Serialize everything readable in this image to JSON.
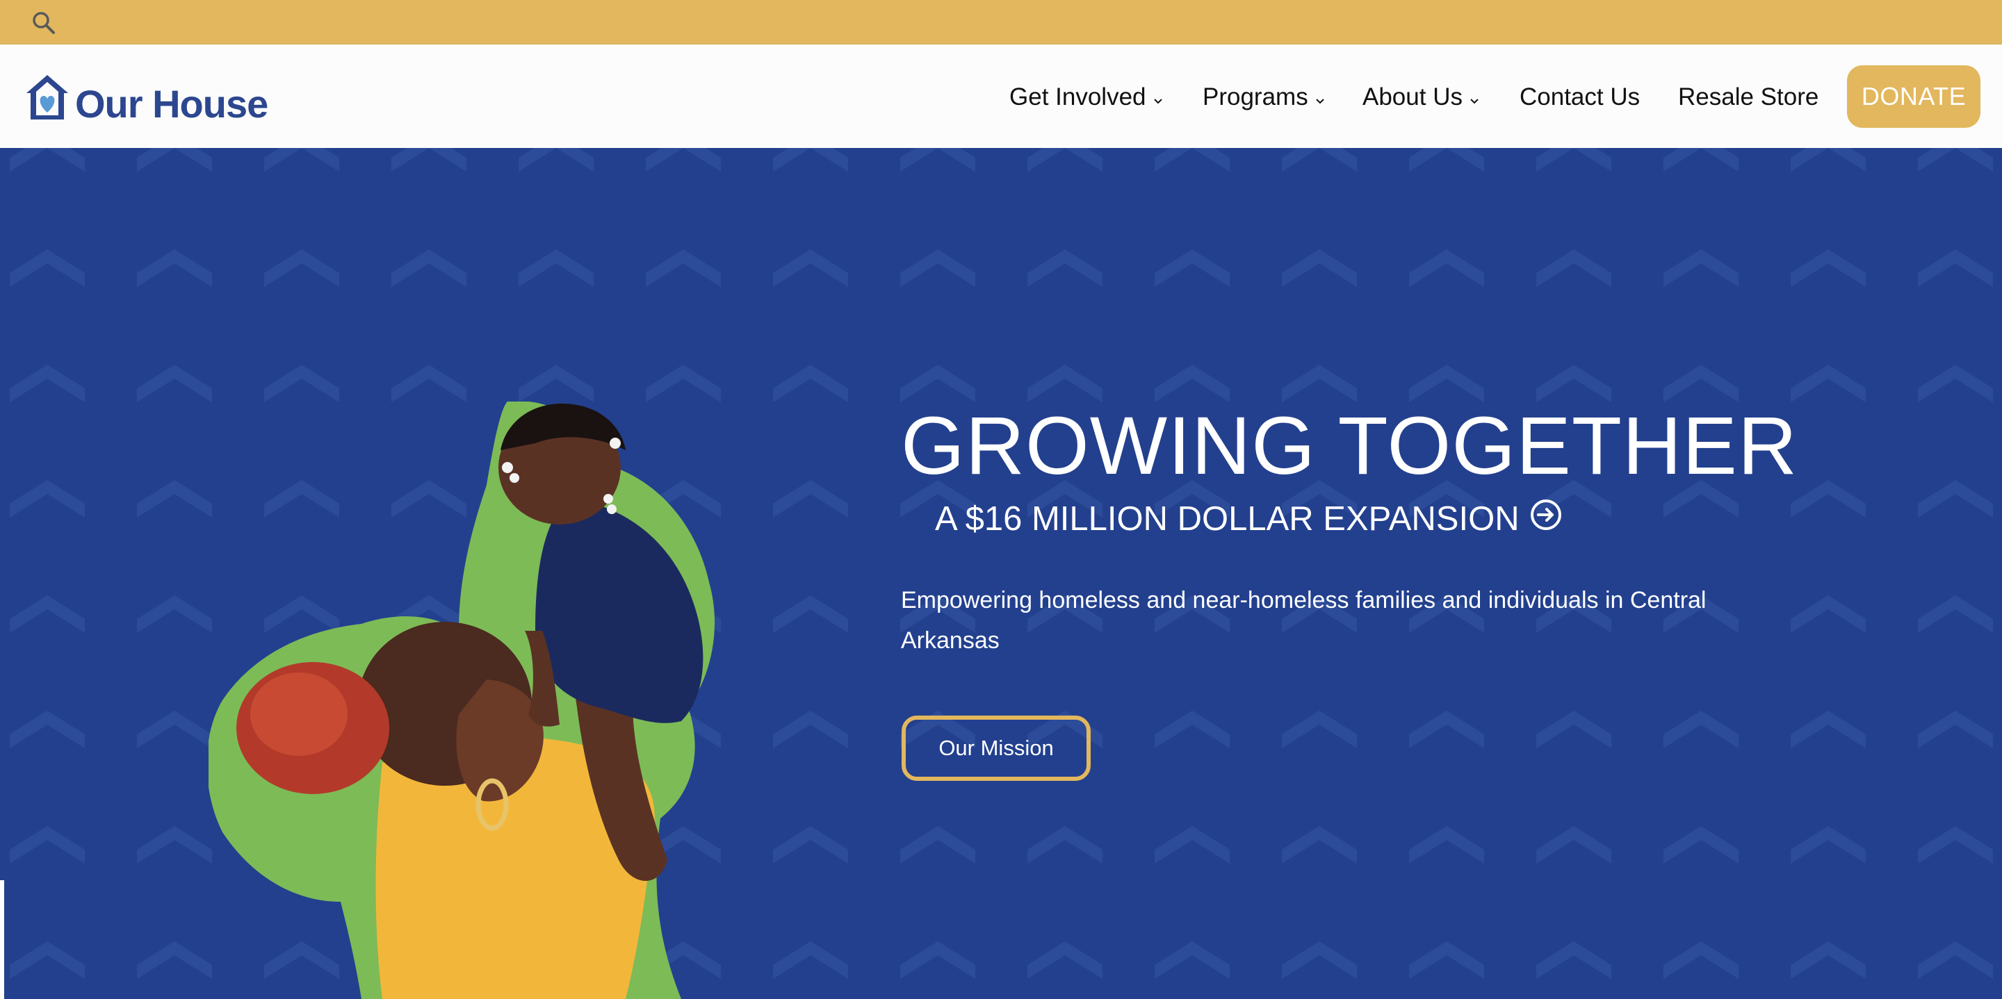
{
  "topbar": {
    "search_icon": "search-icon",
    "color": "#e2b75e"
  },
  "header": {
    "logo": {
      "text": "Our House",
      "icon": "house-heart-icon",
      "color": "#2c478f"
    },
    "nav": [
      {
        "label": "Get Involved",
        "has_dropdown": true
      },
      {
        "label": "Programs",
        "has_dropdown": true
      },
      {
        "label": "About Us",
        "has_dropdown": true
      },
      {
        "label": "Contact Us",
        "has_dropdown": false
      },
      {
        "label": "Resale Store",
        "has_dropdown": false
      }
    ],
    "donate_label": "DONATE"
  },
  "hero": {
    "title": "GROWING TOGETHER",
    "subtitle": "A $16 MILLION DOLLAR EXPANSION",
    "subtitle_icon": "arrow-right-circle-icon",
    "description": "Empowering homeless and near-homeless families and individuals in Central Arkansas",
    "button_label": "Our Mission",
    "background_color": "#23408e",
    "accent_color": "#e2b75e",
    "photo_outline_color": "#7dbb57"
  }
}
